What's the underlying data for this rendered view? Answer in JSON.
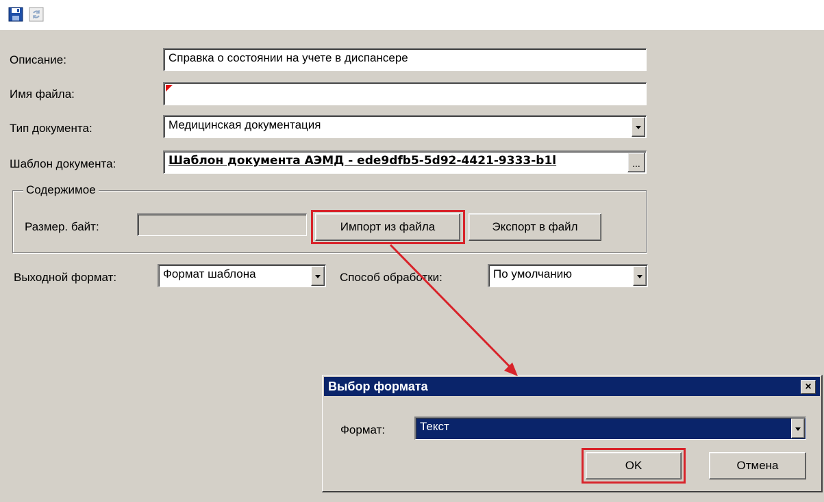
{
  "toolbar": {
    "save_icon": "save-icon",
    "refresh_icon": "refresh-icon"
  },
  "form": {
    "description_label": "Описание:",
    "description_value": "Справка о состоянии на учете в диспансере",
    "filename_label": "Имя файла:",
    "filename_value": "",
    "doctype_label": "Тип документа:",
    "doctype_value": "Медицинская документация",
    "template_label": "Шаблон документа:",
    "template_value": "Шаблон документа АЭМД - ede9dfb5-5d92-4421-9333-b1l",
    "template_browse": "...",
    "content_group": "Содержимое",
    "size_label": "Размер. байт:",
    "size_value": "",
    "import_button": "Импорт из файла",
    "export_button": "Экспорт в файл",
    "output_format_label": "Выходной формат:",
    "output_format_value": "Формат шаблона",
    "processing_label": "Способ обработки:",
    "processing_value": "По умолчанию"
  },
  "dialog": {
    "title": "Выбор формата",
    "close": "×",
    "format_label": "Формат:",
    "format_value": "Текст",
    "ok_button": "OK",
    "cancel_button": "Отмена"
  },
  "colors": {
    "highlight": "#d8232a",
    "selection": "#0a246a",
    "window": "#d4d0c8"
  }
}
